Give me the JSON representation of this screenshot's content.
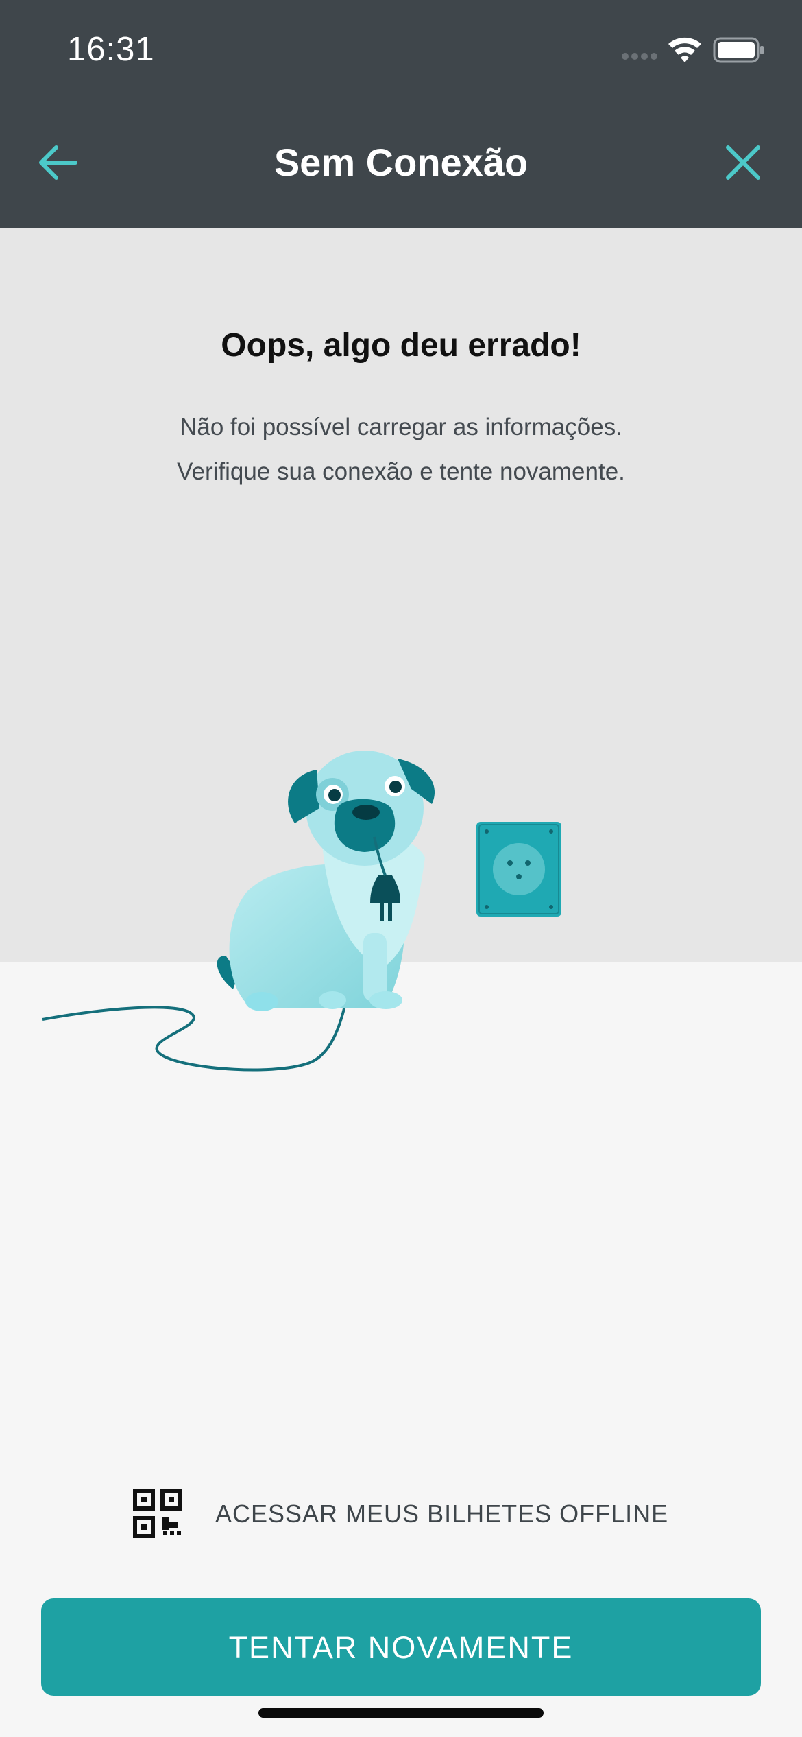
{
  "status_bar": {
    "time": "16:31",
    "icons": [
      "signal-icon",
      "wifi-icon",
      "battery-icon"
    ]
  },
  "nav": {
    "title": "Sem Conexão",
    "back_icon": "arrow-left-icon",
    "close_icon": "close-icon"
  },
  "error": {
    "heading": "Oops, algo deu errado!",
    "line1": "Não foi possível carregar as informações.",
    "line2": "Verifique sua conexão e tente novamente."
  },
  "offline": {
    "label": "ACESSAR MEUS BILHETES OFFLINE",
    "icon": "qr-code-icon"
  },
  "retry": {
    "label": "TENTAR NOVAMENTE"
  },
  "colors": {
    "header_bg": "#3f464b",
    "accent": "#1ea1a3",
    "icon_accent": "#4cc9c9",
    "top_panel_bg": "#e6e6e6",
    "page_bg": "#f6f6f6"
  }
}
